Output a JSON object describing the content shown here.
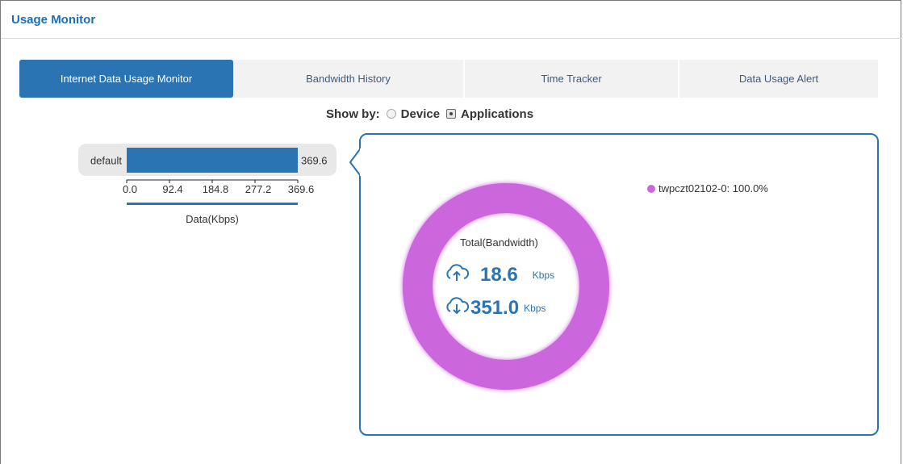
{
  "page": {
    "title": "Usage Monitor"
  },
  "tabs": [
    {
      "label": "Internet Data Usage Monitor",
      "active": true
    },
    {
      "label": "Bandwidth History",
      "active": false
    },
    {
      "label": "Time Tracker",
      "active": false
    },
    {
      "label": "Data Usage Alert",
      "active": false
    }
  ],
  "show_by": {
    "label": "Show by:",
    "options": [
      {
        "label": "Device",
        "checked": false
      },
      {
        "label": "Applications",
        "checked": true
      }
    ]
  },
  "colors": {
    "accent": "#2a74b3",
    "donut": "#cc66dd",
    "tab_bg": "#f2f2f2"
  },
  "bandwidth": {
    "total_label": "Total(Bandwidth)",
    "upload": {
      "value": "18.6",
      "unit": "Kbps",
      "icon": "cloud-upload-icon"
    },
    "download": {
      "value": "351.0",
      "unit": "Kbps",
      "icon": "cloud-download-icon"
    },
    "legend": [
      {
        "label": "twpczt02102-0: 100.0%",
        "color": "#cc66dd"
      }
    ]
  },
  "chart_data": [
    {
      "type": "bar",
      "orientation": "horizontal",
      "categories": [
        "default"
      ],
      "values": [
        369.6
      ],
      "value_labels": [
        "369.6"
      ],
      "xlabel": "Data(Kbps)",
      "xlim": [
        0,
        369.6
      ],
      "ticks": [
        "0.0",
        "92.4",
        "184.8",
        "277.2",
        "369.6"
      ],
      "grid": false
    },
    {
      "type": "pie",
      "style": "donut",
      "slices": [
        {
          "label": "twpczt02102-0",
          "value": 100.0
        }
      ],
      "legend_position": "top-right"
    }
  ]
}
